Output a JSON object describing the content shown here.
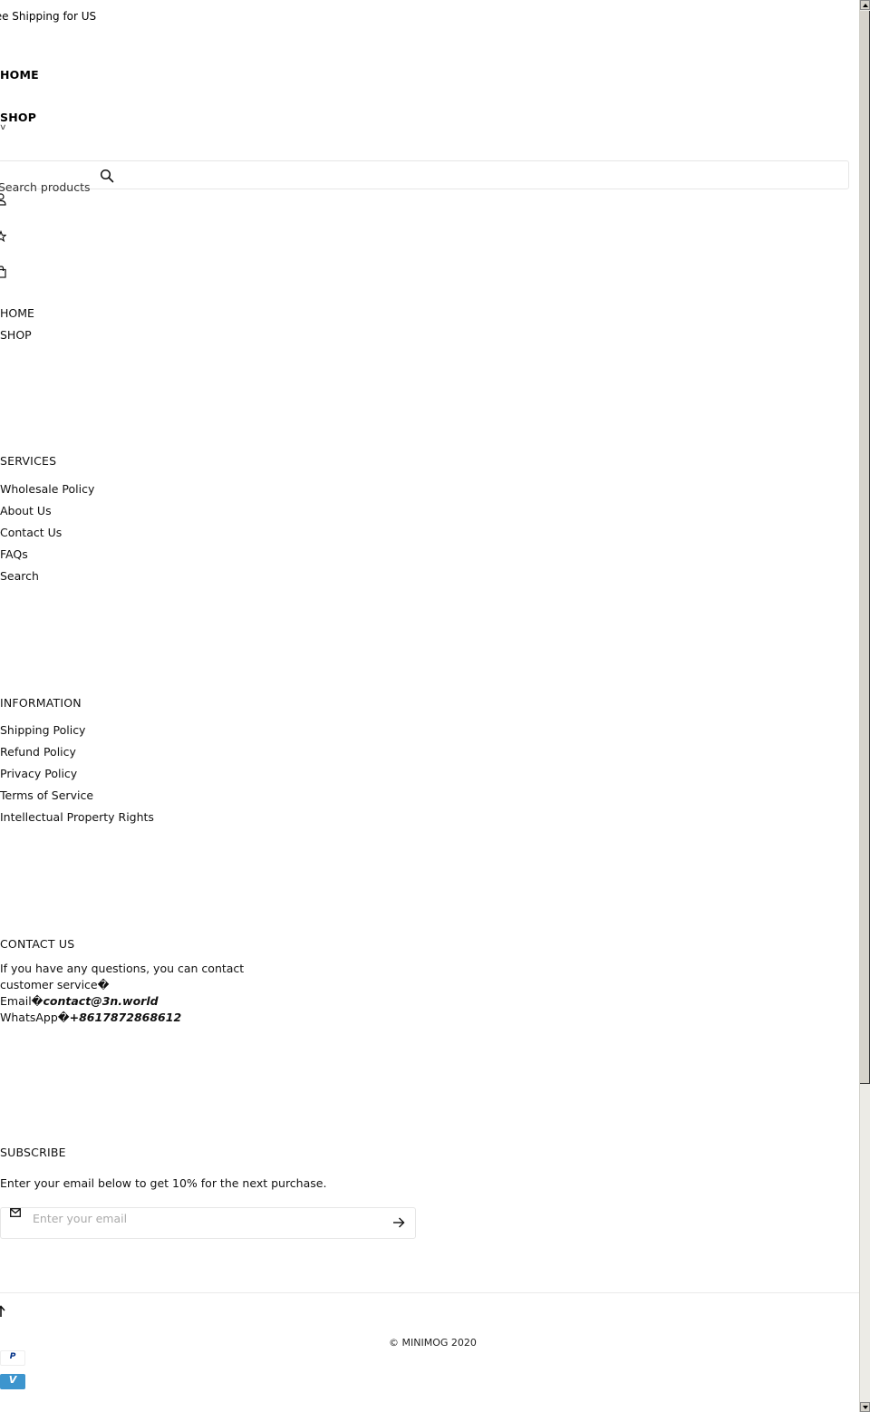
{
  "announcement": "Free Shipping for US",
  "header": {
    "nav": [
      {
        "label": "HOME"
      },
      {
        "label": "SHOP"
      }
    ],
    "search": {
      "placeholder": "Search products"
    },
    "icons": [
      "user-icon",
      "star-icon",
      "shopping-bag-icon",
      "search-icon"
    ]
  },
  "mobile_nav": [
    {
      "label": "HOME"
    },
    {
      "label": "SHOP"
    }
  ],
  "footer": {
    "services": {
      "title": "SERVICES",
      "links": [
        "Wholesale Policy",
        "About Us",
        "Contact Us",
        "FAQs",
        "Search"
      ]
    },
    "information": {
      "title": "INFORMATION",
      "links": [
        "Shipping Policy",
        "Refund Policy",
        "Privacy Policy",
        "Terms of Service",
        "Intellectual Property Rights"
      ]
    },
    "contact": {
      "title": "CONTACT US",
      "line1": "If you have any questions, you can contact",
      "line2": "customer service�",
      "email_label": "Email�",
      "email": "contact@3n.world",
      "whatsapp_label": "WhatsApp�",
      "whatsapp": "+8617872868612"
    },
    "subscribe": {
      "title": "SUBSCRIBE",
      "text": "Enter your email below to get 10% for the next purchase.",
      "placeholder": "Enter your email"
    },
    "copyright": "© MINIMOG 2020",
    "payments": [
      {
        "name": "PayPal",
        "glyph": "P",
        "color": "#003087"
      },
      {
        "name": "Venmo",
        "glyph": "V",
        "color": "#3d95ce"
      }
    ]
  }
}
